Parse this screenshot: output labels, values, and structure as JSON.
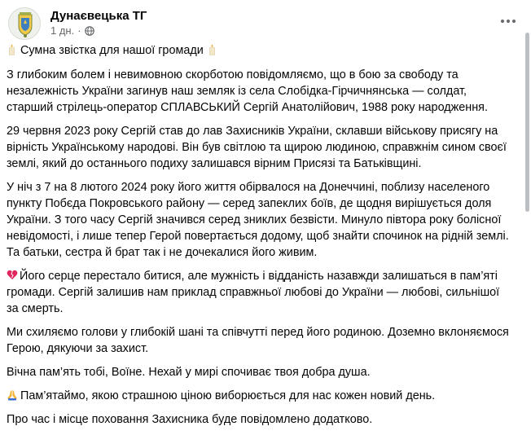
{
  "header": {
    "page_name": "Дунаєвецька ТГ",
    "time": "1 дн.",
    "separator": "·",
    "icons": {
      "avatar": "community-crest-avatar",
      "privacy": "globe-icon",
      "more": "more-options-icon"
    }
  },
  "post": {
    "title": "Сумна звістка для нашої громади",
    "paragraphs": [
      "З глибоким болем і невимовною скорботою повідомляємо, що в бою за свободу та незалежність України загинув наш земляк із села Слобідка-Гірчичнянська — солдат, старший стрілець-оператор СПЛАВСЬКИЙ Сергій Анатолійович, 1988 року народження.",
      "29 червня 2023 року Сергій став до лав Захисників України, склавши військову присягу на вірність Українському народові. Він був світлою та щирою людиною, справжнім сином своєї землі, який до останнього подиху залишався вірним Присязі та Батьківщині.",
      "У ніч з 7 на 8 лютого 2024 року його життя обірвалося на Донеччині, поблизу населеного пункту Побєда Покровського району — серед запеклих боїв, де щодня вирішується доля України. З того часу Сергій значився серед зниклих безвісти. Минуло півтора року болісної невідомості, і лише тепер Герой повертається додому, щоб знайти спочинок на рідній землі. Та батьки, сестра й брат так і не дочекалися його живим.",
      "Його серце перестало битися, але мужність і відданість назавжди залишаться в пам’яті громади. Сергій залишив нам приклад справжньої любові до України — любові, сильнішої за смерть.",
      "Ми схиляємо голови у глибокій шані та співчутті перед його родиною. Доземно вклоняємося Герою, дякуючи за захист.",
      "Вічна пам’ять тобі, Воїне. Нехай у мирі спочиває твоя добра душа.",
      "Пам’ятаймо, якою страшною ціною виборюється для нас кожен новий день.",
      "Про час і місце поховання Захисника буде повідомлено додатково."
    ],
    "emojis": {
      "candle": "candle-icon",
      "heart": "broken-heart-icon",
      "hands": "folded-hands-icon"
    }
  }
}
